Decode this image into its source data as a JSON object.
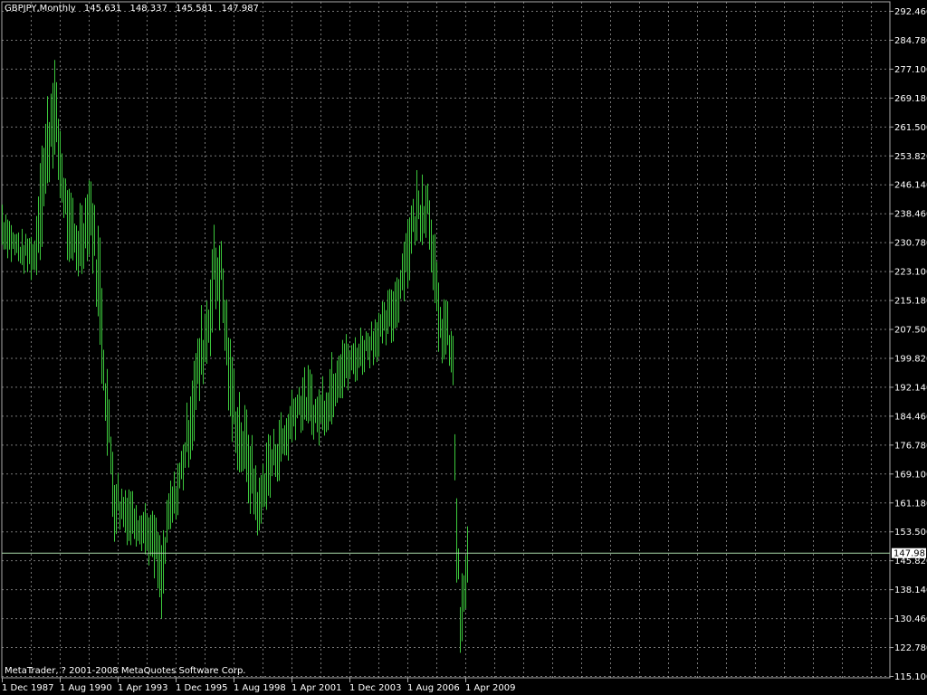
{
  "header": {
    "symbol": "GBPJPY,Monthly",
    "open": "145.631",
    "high": "148.337",
    "low": "145.581",
    "close": "147.987"
  },
  "footer": {
    "copyright": "MetaTrader, ? 2001-2008 MetaQuotes Software Corp."
  },
  "colors": {
    "background": "#000000",
    "grid": "#aaaaaa",
    "bars": "#3cc83c",
    "axis_text": "#ffffff",
    "bid_line": "#a8d8a8"
  },
  "chart_data": {
    "type": "ohlc",
    "title": "GBPJPY,Monthly",
    "y_ticks": [
      "292.460",
      "284.780",
      "277.100",
      "269.180",
      "261.500",
      "253.820",
      "246.140",
      "238.460",
      "230.780",
      "223.100",
      "215.180",
      "207.500",
      "199.820",
      "192.140",
      "184.460",
      "176.780",
      "169.100",
      "161.180",
      "153.500",
      "145.820",
      "138.140",
      "130.460",
      "122.780",
      "115.100"
    ],
    "x_ticks": [
      "1 Dec 1987",
      "1 Aug 1990",
      "1 Apr 1993",
      "1 Dec 1995",
      "1 Aug 1998",
      "1 Apr 2001",
      "1 Dec 2003",
      "1 Aug 2006",
      "1 Apr 2009"
    ],
    "ylim": [
      115.1,
      292.46
    ],
    "current_price": "147.987",
    "grid": true,
    "series": [
      {
        "values": [
          {
            "date": "1987-12",
            "low": 228,
            "high": 243
          },
          {
            "date": "1988-06",
            "low": 225,
            "high": 236
          },
          {
            "date": "1988-12",
            "low": 222,
            "high": 234
          },
          {
            "date": "1989-06",
            "low": 220,
            "high": 234
          },
          {
            "date": "1989-09",
            "low": 226,
            "high": 258
          },
          {
            "date": "1990-01",
            "low": 240,
            "high": 270
          },
          {
            "date": "1990-04",
            "low": 250,
            "high": 287
          },
          {
            "date": "1990-08",
            "low": 242,
            "high": 262
          },
          {
            "date": "1991-01",
            "low": 222,
            "high": 245
          },
          {
            "date": "1991-06",
            "low": 220,
            "high": 240
          },
          {
            "date": "1992-01",
            "low": 228,
            "high": 250
          },
          {
            "date": "1992-06",
            "low": 200,
            "high": 232
          },
          {
            "date": "1992-10",
            "low": 172,
            "high": 198
          },
          {
            "date": "1993-02",
            "low": 150,
            "high": 176
          },
          {
            "date": "1993-06",
            "low": 150,
            "high": 170
          },
          {
            "date": "1994-01",
            "low": 150,
            "high": 164
          },
          {
            "date": "1994-06",
            "low": 148,
            "high": 162
          },
          {
            "date": "1995-01",
            "low": 140,
            "high": 158
          },
          {
            "date": "1995-04",
            "low": 130,
            "high": 150
          },
          {
            "date": "1995-08",
            "low": 150,
            "high": 166
          },
          {
            "date": "1996-01",
            "low": 158,
            "high": 172
          },
          {
            "date": "1996-06",
            "low": 168,
            "high": 188
          },
          {
            "date": "1997-01",
            "low": 185,
            "high": 212
          },
          {
            "date": "1997-06",
            "low": 198,
            "high": 222
          },
          {
            "date": "1997-09",
            "low": 205,
            "high": 240
          },
          {
            "date": "1998-01",
            "low": 208,
            "high": 236
          },
          {
            "date": "1998-06",
            "low": 180,
            "high": 205
          },
          {
            "date": "1998-10",
            "low": 170,
            "high": 192
          },
          {
            "date": "1999-04",
            "low": 160,
            "high": 185
          },
          {
            "date": "1999-10",
            "low": 150,
            "high": 168
          },
          {
            "date": "2000-01",
            "low": 158,
            "high": 178
          },
          {
            "date": "2000-06",
            "low": 165,
            "high": 182
          },
          {
            "date": "2001-01",
            "low": 170,
            "high": 188
          },
          {
            "date": "2001-06",
            "low": 178,
            "high": 196
          },
          {
            "date": "2002-01",
            "low": 180,
            "high": 198
          },
          {
            "date": "2002-06",
            "low": 176,
            "high": 192
          },
          {
            "date": "2003-01",
            "low": 180,
            "high": 200
          },
          {
            "date": "2003-06",
            "low": 188,
            "high": 208
          },
          {
            "date": "2004-01",
            "low": 192,
            "high": 205
          },
          {
            "date": "2004-06",
            "low": 195,
            "high": 208
          },
          {
            "date": "2005-01",
            "low": 198,
            "high": 212
          },
          {
            "date": "2005-06",
            "low": 200,
            "high": 215
          },
          {
            "date": "2006-01",
            "low": 205,
            "high": 222
          },
          {
            "date": "2006-06",
            "low": 215,
            "high": 235
          },
          {
            "date": "2007-01",
            "low": 228,
            "high": 250
          },
          {
            "date": "2007-07",
            "low": 232,
            "high": 251
          },
          {
            "date": "2007-10",
            "low": 218,
            "high": 240
          },
          {
            "date": "2008-01",
            "low": 195,
            "high": 220
          },
          {
            "date": "2008-06",
            "low": 200,
            "high": 215
          },
          {
            "date": "2008-09",
            "low": 185,
            "high": 208
          },
          {
            "date": "2008-11",
            "low": 140,
            "high": 165
          },
          {
            "date": "2009-01",
            "low": 118,
            "high": 140
          },
          {
            "date": "2009-03",
            "low": 125,
            "high": 145
          },
          {
            "date": "2009-05",
            "low": 140,
            "high": 155
          }
        ]
      }
    ]
  }
}
